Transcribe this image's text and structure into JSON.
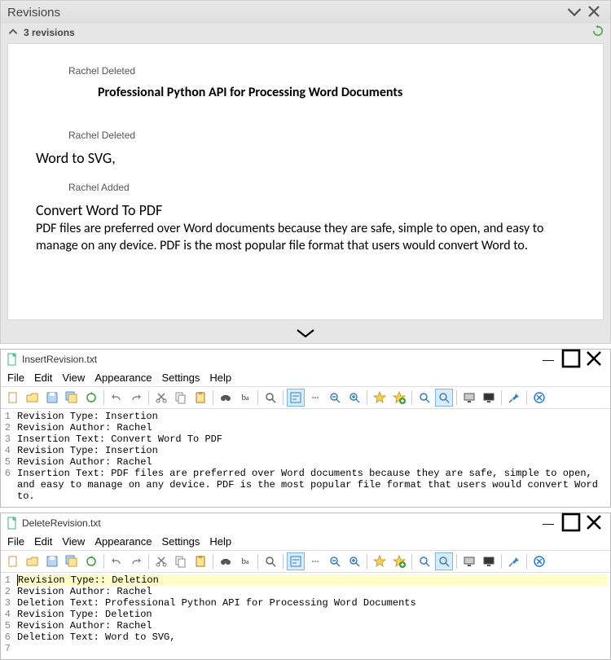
{
  "revisions_panel": {
    "title": "Revisions",
    "count_label": "3 revisions",
    "entries": [
      {
        "meta": "Rachel Deleted",
        "heading": "Professional Python API for Processing Word Documents",
        "body": ""
      },
      {
        "meta": "Rachel Deleted",
        "heading": "Word to SVG,",
        "body": ""
      },
      {
        "meta": "Rachel Added",
        "heading": "Convert Word To PDF",
        "body": "PDF files are preferred over Word documents because they are safe, simple to open, and easy to manage on any device. PDF is the most popular file format that users would convert Word to."
      }
    ]
  },
  "menus": [
    "File",
    "Edit",
    "View",
    "Appearance",
    "Settings",
    "Help"
  ],
  "editors": [
    {
      "filename": "InsertRevision.txt",
      "highlight_first": false,
      "lines": [
        "Revision Type: Insertion",
        "Revision Author: Rachel",
        "Insertion Text: Convert Word To PDF",
        "Revision Type: Insertion",
        "Revision Author: Rachel",
        "Insertion Text: PDF files are preferred over Word documents because they are safe, simple to open, and easy to manage on any device. PDF is the most popular file format that users would convert Word to."
      ]
    },
    {
      "filename": "DeleteRevision.txt",
      "highlight_first": true,
      "lines": [
        "Revision Type:: Deletion",
        "Revision Author: Rachel",
        "Deletion Text: Professional Python API for Processing Word Documents",
        "Revision Type: Deletion",
        "Revision Author: Rachel",
        "Deletion Text: Word to SVG,"
      ]
    }
  ]
}
